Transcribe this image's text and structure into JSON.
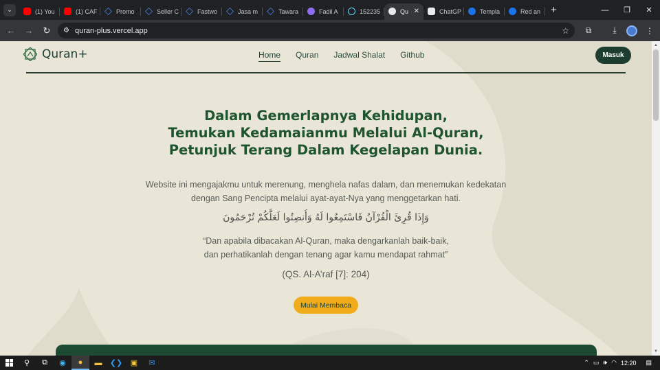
{
  "browser": {
    "tabs": [
      {
        "label": "(1) You",
        "icon": "youtube-icon",
        "active": false
      },
      {
        "label": "(1) CAF",
        "icon": "youtube-icon",
        "active": false
      },
      {
        "label": "Promo",
        "icon": "triangle-logo-icon",
        "active": false
      },
      {
        "label": "Seller C",
        "icon": "triangle-logo-icon",
        "active": false
      },
      {
        "label": "Fastwo",
        "icon": "triangle-logo-icon",
        "active": false
      },
      {
        "label": "Jasa m",
        "icon": "triangle-logo-icon",
        "active": false
      },
      {
        "label": "Tawara",
        "icon": "triangle-logo-icon",
        "active": false
      },
      {
        "label": "Fadil A",
        "icon": "purple-circle-icon",
        "active": false
      },
      {
        "label": "152235",
        "icon": "react-icon",
        "active": false
      },
      {
        "label": "Qu",
        "icon": "quran-favicon",
        "active": true
      },
      {
        "label": "ChatGP",
        "icon": "chatgpt-icon",
        "active": false
      },
      {
        "label": "Templa",
        "icon": "canva-icon",
        "active": false
      },
      {
        "label": "Red an",
        "icon": "canva-icon",
        "active": false
      }
    ],
    "url": "quran-plus.vercel.app"
  },
  "site": {
    "brand": "Quran+",
    "nav": [
      {
        "label": "Home",
        "active": true
      },
      {
        "label": "Quran",
        "active": false
      },
      {
        "label": "Jadwal Shalat",
        "active": false
      },
      {
        "label": "Github",
        "active": false
      }
    ],
    "login_label": "Masuk",
    "colors": {
      "primary": "#1d3d31",
      "accent": "#f0ac1a",
      "background": "#eae6d7",
      "title": "#1f5431"
    }
  },
  "hero": {
    "title_lines": [
      "Dalam Gemerlapnya Kehidupan,",
      "Temukan Kedamaianmu Melalui Al-Quran,",
      "Petunjuk Terang Dalam Kegelapan Dunia."
    ],
    "description_lines": [
      "Website ini mengajakmu untuk merenung, menghela nafas dalam, dan menemukan kedekatan",
      "dengan Sang Pencipta melalui ayat-ayat-Nya yang menggetarkan hati."
    ],
    "arabic": "وَإِذَا قُرِئَ الْقُرْآنُ فَاسْتَمِعُوا لَهُ وَأَنصِتُوا لَعَلَّكُمْ تُرْحَمُونَ",
    "translation_lines": [
      "“Dan apabila dibacakan Al-Quran, maka dengarkanlah baik-baik,",
      "dan perhatikanlah dengan tenang agar kamu mendapat rahmat”"
    ],
    "reference": "(QS. Al-A’raf [7]: 204)",
    "cta_label": "Mulai Membaca"
  },
  "taskbar": {
    "time": "12:20"
  }
}
